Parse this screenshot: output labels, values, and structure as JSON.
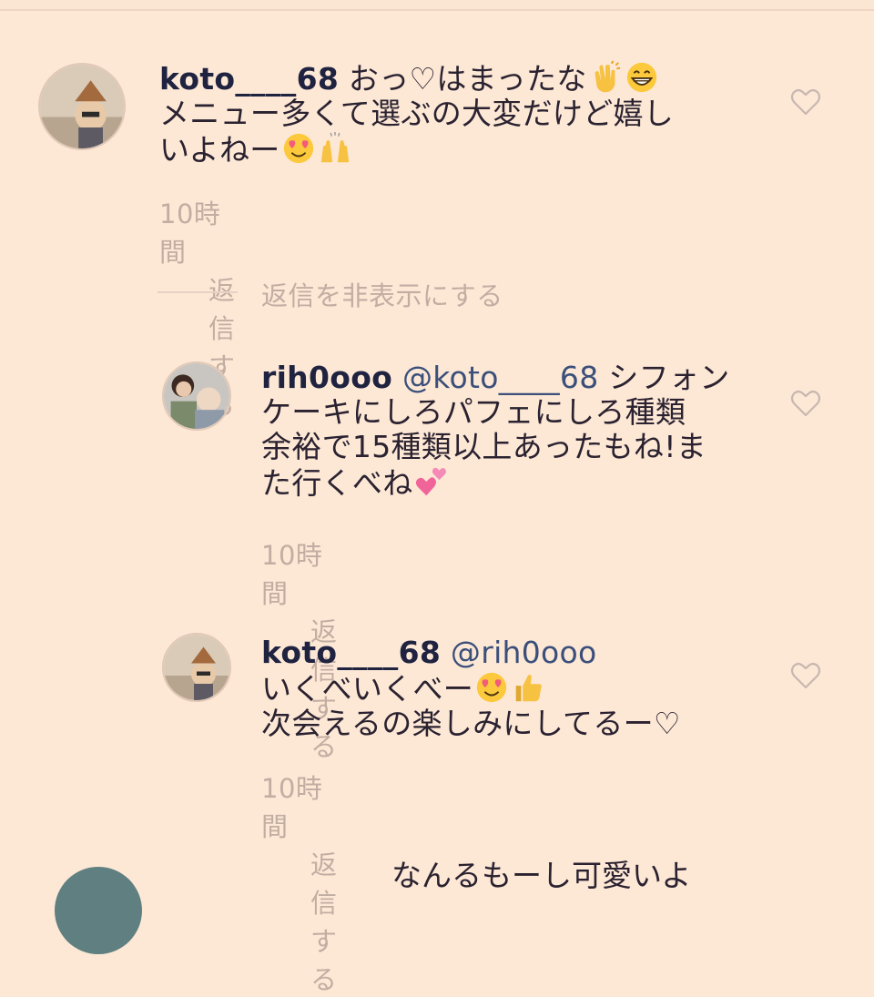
{
  "comments": [
    {
      "username": "koto____68",
      "text_line1": " おっ♡はまったな",
      "text_line2": "メニュー多くて選ぶの大変だけど嬉し",
      "text_line3": "いよねー",
      "emojis": [
        "clapping-hands",
        "grinning-face",
        "heart-eyes-face",
        "raised-hands"
      ],
      "time": "10時間",
      "reply_label": "返信する"
    },
    {
      "username": "rih0ooo",
      "mention": " @koto____68",
      "text_line1": " シフォン",
      "text_line2": "ケーキにしろパフェにしろ種類",
      "text_line3": "余裕で15種類以上あったもね!ま",
      "text_line4": "た行くべね",
      "emojis": [
        "two-hearts"
      ],
      "time": "10時間",
      "reply_label": "返信する"
    },
    {
      "username": "koto____68",
      "mention": " @rih0ooo",
      "text_line1": "いくべいくべー",
      "text_line2": "次会えるの楽しみにしてるー♡",
      "emojis": [
        "heart-eyes-face",
        "thumbs-up"
      ],
      "time": "10時間",
      "reply_label": "返信する"
    }
  ],
  "hide_replies_label": "返信を非表示にする",
  "partial_next_comment": "なんるもーし可愛いよ",
  "colors": {
    "background": "#fde8d6",
    "username": "#1f2340",
    "mention": "#3a4f7a",
    "meta": "#c2ada2"
  }
}
